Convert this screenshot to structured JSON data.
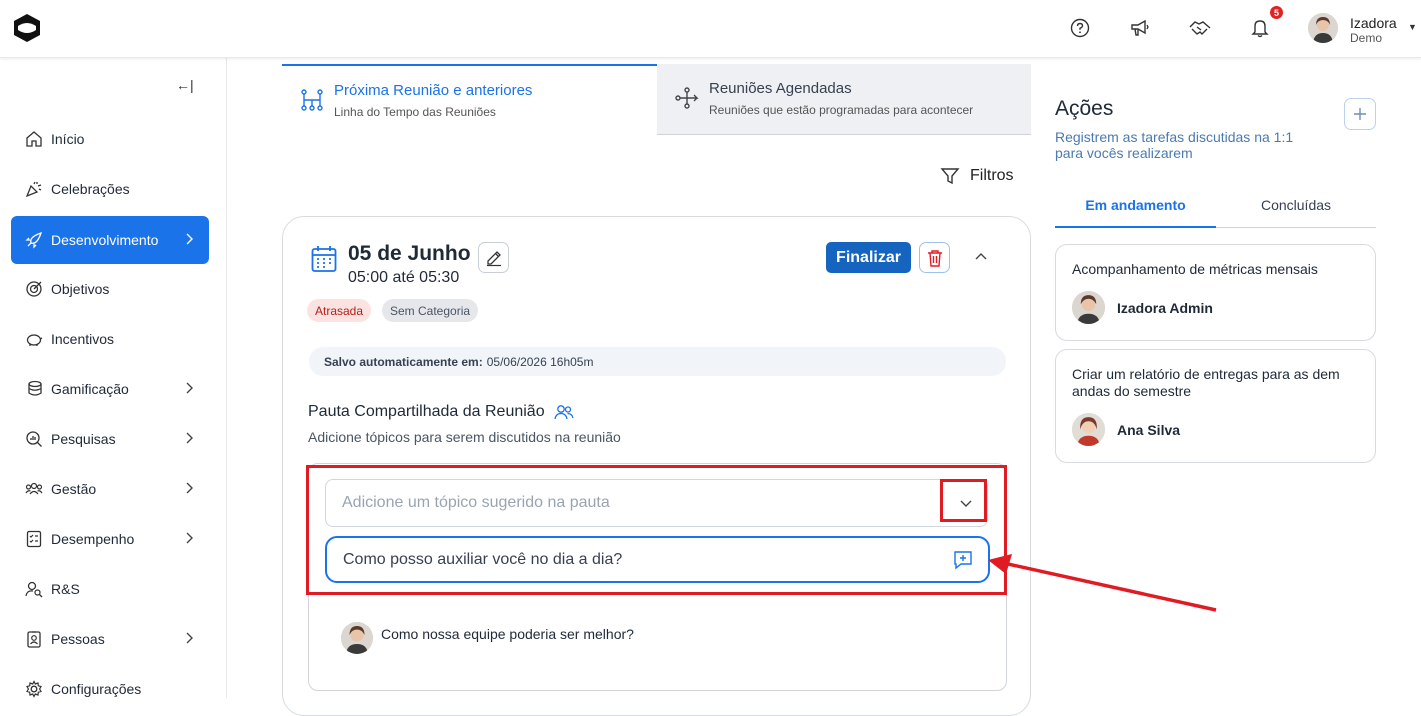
{
  "topbar": {
    "user_name": "Izadora",
    "user_role": "Demo",
    "notification_count": "5",
    "icons": [
      "help-icon",
      "megaphone-icon",
      "handshake-icon",
      "bell-icon"
    ]
  },
  "sidebar": {
    "items": [
      {
        "label": "Início",
        "icon": "home-icon"
      },
      {
        "label": "Celebrações",
        "icon": "party-icon"
      },
      {
        "label": "Desenvolvimento",
        "icon": "rocket-icon"
      },
      {
        "label": "Objetivos",
        "icon": "target-icon"
      },
      {
        "label": "Incentivos",
        "icon": "piggy-bank-icon"
      },
      {
        "label": "Gamificação",
        "icon": "coins-icon"
      },
      {
        "label": "Pesquisas",
        "icon": "search-chart-icon"
      },
      {
        "label": "Gestão",
        "icon": "team-icon"
      },
      {
        "label": "Desempenho",
        "icon": "checklist-icon"
      },
      {
        "label": "R&S",
        "icon": "user-search-icon"
      },
      {
        "label": "Pessoas",
        "icon": "badge-icon"
      },
      {
        "label": "Configurações",
        "icon": "gear-icon"
      }
    ],
    "active": "Desenvolvimento"
  },
  "tabs": [
    {
      "title": "Próxima Reunião e anteriores",
      "subtitle": "Linha do Tempo das Reuniões"
    },
    {
      "title": "Reuniões Agendadas",
      "subtitle": "Reuniões que estão programadas para acontecer"
    }
  ],
  "filters_label": "Filtros",
  "meeting": {
    "date": "05 de Junho",
    "time": "05:00 até 05:30",
    "finalize_label": "Finalizar",
    "tags": [
      "Atrasada",
      "Sem Categoria"
    ],
    "saved_label": "Salvo automaticamente em:",
    "saved_value": "05/06/2026 16h05m",
    "agenda_title": "Pauta Compartilhada da Reunião",
    "agenda_subtitle": "Adicione tópicos para serem discutidos na reunião",
    "suggest_placeholder": "Adicione um tópico sugerido na pauta",
    "topic_input_value": "Como posso auxiliar você no dia a dia?",
    "topics": [
      "Como nossa equipe poderia ser melhor?"
    ]
  },
  "actions": {
    "title": "Ações",
    "subtitle": "Registrem as tarefas discutidas na 1:1 para vocês realizarem",
    "tab_active": "Em andamento",
    "tab_done": "Concluídas",
    "items": [
      {
        "text": "Acompanhamento de métricas mensais",
        "person": "Izadora Admin"
      },
      {
        "text": "Criar um relatório de entregas para as dem andas do semestre",
        "person": "Ana Silva"
      }
    ]
  },
  "colors": {
    "accent": "#1a73e8",
    "highlight": "#e01b24",
    "finalize": "#1565c0"
  }
}
